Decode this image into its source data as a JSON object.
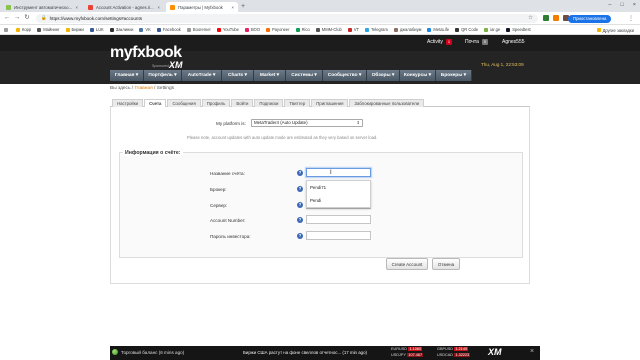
{
  "browser": {
    "tabs": [
      {
        "label": "Инструмент автоматическо...",
        "color": "#8bc34a",
        "active": false
      },
      {
        "label": "Account Activation - agnes.ri...",
        "color": "#ea4335",
        "active": false
      },
      {
        "label": "Параметры | Myfxbook",
        "color": "#ff8f00",
        "active": true
      }
    ],
    "new_tab": "+",
    "url": "https://www.myfxbook.com/settings#accounts",
    "profile_label": "Приостановлена",
    "bookmarks": [
      {
        "label": "Корр",
        "color": "#f4b400"
      },
      {
        "label": "Майнинг",
        "color": "#555555"
      },
      {
        "label": "Биржи",
        "color": "#f4b400"
      },
      {
        "label": "LUK",
        "color": "#3b5998"
      },
      {
        "label": "Заклинки",
        "color": "#333333"
      },
      {
        "label": "VK",
        "color": "#4a76a8"
      },
      {
        "label": "Facebook",
        "color": "#3b5998"
      },
      {
        "label": "Booremer",
        "color": "#999999"
      },
      {
        "label": "YouTube",
        "color": "#ff0000"
      },
      {
        "label": "BOO",
        "color": "#e91e63"
      },
      {
        "label": "Payoneer",
        "color": "#ff6d00"
      },
      {
        "label": "Rico",
        "color": "#0f9d58"
      },
      {
        "label": "MMM-Club",
        "color": "#555555"
      },
      {
        "label": "VT",
        "color": "#c62828"
      },
      {
        "label": "Telegram",
        "color": "#2ca5e0"
      },
      {
        "label": "джалабиум",
        "color": "#8d6e63"
      },
      {
        "label": "MetaLife",
        "color": "#1e88e5"
      },
      {
        "label": "QR Code",
        "color": "#333333"
      },
      {
        "label": "iar.ge",
        "color": "#7cb342"
      },
      {
        "label": "Speedtest",
        "color": "#141526"
      }
    ],
    "bookmarks_other": "Другие закладки"
  },
  "site": {
    "topbar": {
      "activity": "Activity",
      "activity_count": "1",
      "mail": "Почта",
      "mail_count": "0",
      "user": "Agnes555"
    },
    "logo_main": "myfx",
    "logo_book": "book",
    "sponsored": "Sponsored by",
    "sponsor_logo": "XM",
    "datetime": "Thu, Aug 1, 22:53:09",
    "menu": [
      "Главная ▾",
      "Портфель ▾",
      "AutoTrade ▾",
      "Charts ▾",
      "Market ▾",
      "Системы ▾",
      "Сообщество ▾",
      "Обзоры ▾",
      "Конкурсы ▾",
      "Брокеры ▾"
    ],
    "breadcrumb": {
      "prefix": "Вы здесь / ",
      "link": "Главная",
      "sep": " / ",
      "current": "Settings"
    },
    "tabs": [
      "Настройки",
      "Счета",
      "Сообщения",
      "Профиль",
      "Войти",
      "Подписки",
      "Твиттер",
      "Приглашения",
      "Заблокированные пользователи"
    ],
    "selected_tab": "Счета"
  },
  "form": {
    "platform_label": "My platform is:",
    "platform_value": "MetaTrader4 (Auto Update)",
    "platform_note": "Please note, account updates with auto update mode are estimated as they very based on server load.",
    "legend": "Информация о счёте:",
    "fields": [
      {
        "label": "Название счёта:",
        "value": ""
      },
      {
        "label": "Брокер:",
        "value": ""
      },
      {
        "label": "Сервер:",
        "value": ""
      },
      {
        "label": "Account Number:",
        "value": ""
      },
      {
        "label": "Пароль инвестора:",
        "value": ""
      }
    ],
    "help_glyph": "?",
    "autocomplete": [
      "Pendi71",
      "Pendi"
    ],
    "create_button": "Create Account",
    "cancel_button": "Отмена"
  },
  "ticker": {
    "label": "Торговый баланс (6 mins ago)",
    "news": "Биржи США растут на фоне свеллов отчетнос... (17 min ago)",
    "pairs": [
      {
        "name": "EURUSD",
        "value": "1.1060"
      },
      {
        "name": "USDJPY",
        "value": "107.467"
      },
      {
        "name": "GBPUSD",
        "value": "1.2149"
      },
      {
        "name": "USDCAD",
        "value": "1.32223"
      }
    ],
    "logo": "XM",
    "close": "×"
  }
}
